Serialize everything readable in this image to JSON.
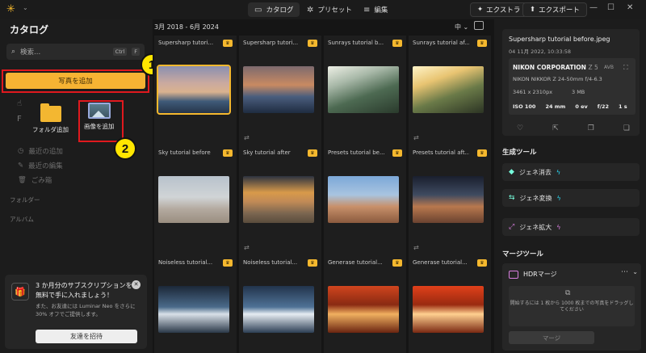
{
  "topbar": {
    "tabs": [
      {
        "label": "カタログ",
        "icon": "catalog-icon",
        "glyph": "▭"
      },
      {
        "label": "プリセット",
        "icon": "presets-icon",
        "glyph": "✲"
      },
      {
        "label": "編集",
        "icon": "edit-icon",
        "glyph": "≡"
      }
    ],
    "extras_label": "エクストラ",
    "export_label": "エクスポート"
  },
  "sidebar": {
    "title": "カタログ",
    "search_placeholder": "検索...",
    "search_kbd": [
      "Ctrl",
      "F"
    ],
    "add_photo_label": "写真を追加",
    "popup": {
      "folder_label": "フォルダ追加",
      "image_label": "画像を追加"
    },
    "faded_items": [
      "最近の追加",
      "最近の編集",
      "ごみ箱"
    ],
    "sections": [
      "フォルダー",
      "アルバム"
    ],
    "promo": {
      "title": "3 か月分のサブスクリプションを無料で手に入れましょう！",
      "desc": "また、お友達には Luminar Neo をさらに 30% オフでご提供します。",
      "button": "友達を招待"
    }
  },
  "annotations": {
    "badge1": "1",
    "badge2": "2"
  },
  "gallery": {
    "date_range": "3月 2018 - 6月 2024",
    "size": "中",
    "items": [
      {
        "name": "Supersharp tutori...",
        "thumb": "linear-gradient(180deg,#8a8fb0 0%,#c9a9a0 35%,#d9b28f 55%,#3f5a78 75%,#26354a 100%)",
        "sel": true
      },
      {
        "name": "Supersharp tutori...",
        "thumb": "linear-gradient(180deg,#7d6a6e 0%,#c98a62 40%,#4a5d7d 65%,#1f2c40 100%)",
        "adj": "⇄"
      },
      {
        "name": "Sunrays tutorial b...",
        "thumb": "linear-gradient(160deg,#eef0e6 0%,#a8b8a8 30%,#4d6a52 60%,#2a3a2c 100%)"
      },
      {
        "name": "Sunrays tutorial af...",
        "thumb": "linear-gradient(160deg,#fff4c8 0%,#e8c472 30%,#6a7a48 60%,#2c3424 100%)",
        "adj": "⇄"
      },
      {
        "name": "Sky tutorial before",
        "thumb": "linear-gradient(180deg,#b8c2cc 0%,#d0d4d6 45%,#b4aaa0 70%,#9a8e80 100%)"
      },
      {
        "name": "Sky tutorial after",
        "thumb": "linear-gradient(180deg,#2d3340 0%,#d89a4a 35%,#c08a56 55%,#7a6550 80%,#5a4c3c 100%)",
        "adj": "⇄"
      },
      {
        "name": "Presets tutorial be...",
        "thumb": "linear-gradient(180deg,#7ca8d8 0%,#a8c4e0 40%,#c8906a 65%,#8a5a3e 100%)"
      },
      {
        "name": "Presets tutorial aft...",
        "thumb": "linear-gradient(180deg,#1a1f2e 0%,#3e4a60 40%,#b8784e 65%,#6a4230 100%)",
        "adj": "⇄"
      },
      {
        "name": "Noiseless tutorial...",
        "thumb": "linear-gradient(180deg,#1c2838 0%,#4a6a8a 45%,#d8e0e8 60%,#2a3848 100%)"
      },
      {
        "name": "Noiseless tutorial...",
        "thumb": "linear-gradient(180deg,#22344c 0%,#4f7296 45%,#e6ecf2 60%,#2c3e54 100%)"
      },
      {
        "name": "Generase tutorial...",
        "thumb": "linear-gradient(180deg,#d0451e 0%,#8a2a12 40%,#f0b060 60%,#6a2410 100%)"
      },
      {
        "name": "Generase tutorial...",
        "thumb": "linear-gradient(180deg,#e0401a 0%,#9a2a10 40%,#ffd090 60%,#7a2812 100%)"
      }
    ]
  },
  "info": {
    "filename": "Supersharp tutorial before.jpeg",
    "datetime": "04 11月 2022, 10:33:58",
    "camera": "NIKON CORPORATION",
    "model_suffix": "Z 5",
    "avb": "AVB",
    "lens": "NIKON NIKKOR Z 24-50mm f/4-6.3",
    "dims": "3461 x 2310px",
    "filesize": "3 MB",
    "stats": [
      "ISO 100",
      "24 mm",
      "0 ev",
      "f/22",
      "1 s"
    ]
  },
  "gen_tools": {
    "title": "生成ツール",
    "items": [
      {
        "label": "ジェネ消去",
        "icon": "eraser-icon",
        "glyph": "◆"
      },
      {
        "label": "ジェネ変換",
        "icon": "swap-icon",
        "glyph": "⇆"
      },
      {
        "label": "ジェネ拡大",
        "icon": "expand-icon",
        "glyph": "⤢"
      }
    ]
  },
  "merge": {
    "title": "マージツール",
    "hdr_title": "HDRマージ",
    "drop_text": "開始するには 1 枚から 1000 枚までの写真をドラッグしてください",
    "button": "マージ"
  }
}
